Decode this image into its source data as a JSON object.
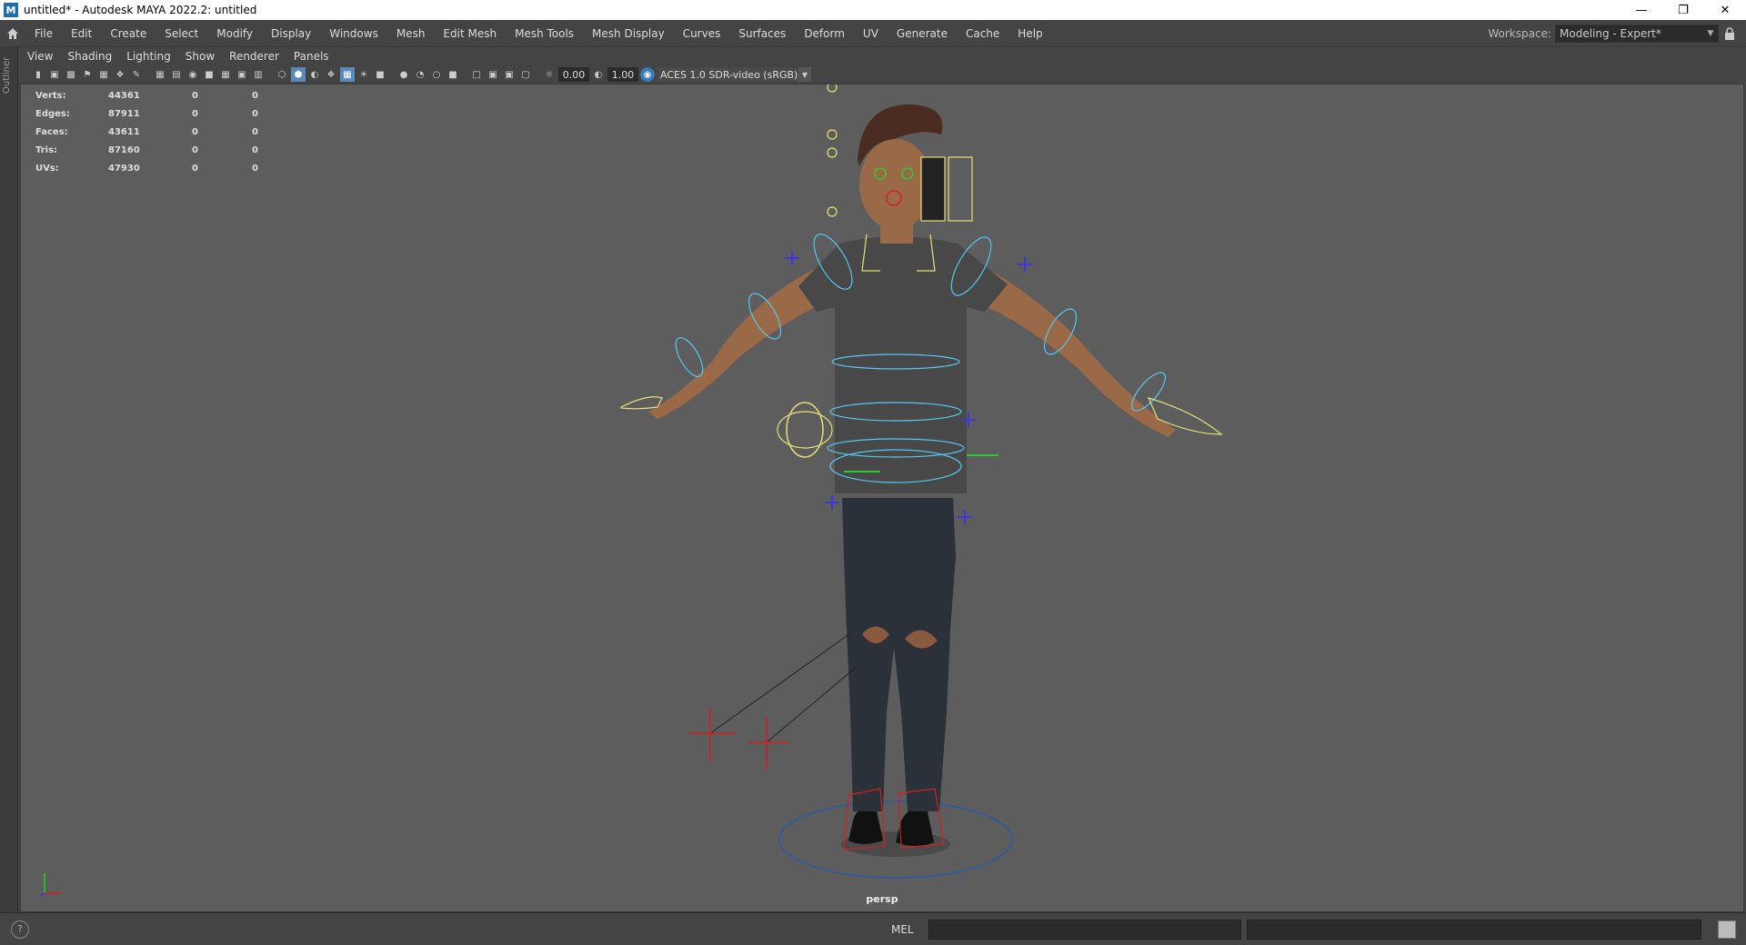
{
  "window": {
    "title": "untitled* - Autodesk MAYA 2022.2: untitled",
    "app_icon": "M",
    "minimize_icon": "minimize-icon",
    "maximize_icon": "restore-icon",
    "close_icon": "close-icon"
  },
  "menubar": {
    "items": [
      "File",
      "Edit",
      "Create",
      "Select",
      "Modify",
      "Display",
      "Windows",
      "Mesh",
      "Edit Mesh",
      "Mesh Tools",
      "Mesh Display",
      "Curves",
      "Surfaces",
      "Deform",
      "UV",
      "Generate",
      "Cache",
      "Help"
    ],
    "workspace_label": "Workspace:",
    "workspace_value": "Modeling - Expert*"
  },
  "outliner_tab": "Outliner",
  "panel_menu": [
    "View",
    "Shading",
    "Lighting",
    "Show",
    "Renderer",
    "Panels"
  ],
  "panel_toolbar": {
    "exposure": "0.00",
    "gamma": "1.00",
    "color_management": "ACES 1.0 SDR-video (sRGB)"
  },
  "hud": {
    "rows": [
      {
        "label": "Verts:",
        "v1": "44361",
        "v2": "0",
        "v3": "0"
      },
      {
        "label": "Edges:",
        "v1": "87911",
        "v2": "0",
        "v3": "0"
      },
      {
        "label": "Faces:",
        "v1": "43611",
        "v2": "0",
        "v3": "0"
      },
      {
        "label": "Tris:",
        "v1": "87160",
        "v2": "0",
        "v3": "0"
      },
      {
        "label": "UVs:",
        "v1": "47930",
        "v2": "0",
        "v3": "0"
      }
    ]
  },
  "viewport": {
    "camera_label": "persp",
    "background": "#5d5d5d"
  },
  "cmdline": {
    "help": "?",
    "language": "MEL"
  },
  "colors": {
    "accent_blue": "#55c8f0",
    "ctrl_yellow": "#e6e07a",
    "ctrl_red": "#d42020",
    "ctrl_green": "#2ec82e",
    "ctrl_blue": "#3a3ad8"
  }
}
